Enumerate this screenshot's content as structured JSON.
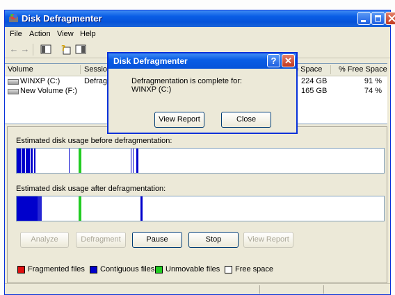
{
  "window": {
    "title": "Disk Defragmenter"
  },
  "menu": [
    "File",
    "Action",
    "View",
    "Help"
  ],
  "table": {
    "columns": [
      "Volume",
      "Session",
      "e Space",
      "% Free Space"
    ],
    "rows": [
      {
        "volume": "WINXP (C:)",
        "session": "Defragm",
        "free_space": "224 GB",
        "pct_free": "91 %"
      },
      {
        "volume": "New Volume (F:)",
        "session": "",
        "free_space": "165 GB",
        "pct_free": "74 %"
      }
    ]
  },
  "before_label": "Estimated disk usage before defragmentation:",
  "after_label": "Estimated disk usage after defragmentation:",
  "buttons": {
    "analyze": "Analyze",
    "defragment": "Defragment",
    "pause": "Pause",
    "stop": "Stop",
    "view_report": "View Report"
  },
  "legend": [
    "Fragmented files",
    "Contiguous files",
    "Unmovable files",
    "Free space"
  ],
  "colors": {
    "fragmented": "#e01010",
    "contiguous": "#0000cc",
    "unmovable": "#22cc22",
    "free": "#ffffff"
  },
  "dialog": {
    "title": "Disk Defragmenter",
    "message": "Defragmentation is complete for:",
    "volume": "WINXP (C:)",
    "view_report": "View Report",
    "close": "Close",
    "help_glyph": "?",
    "close_glyph": "✕"
  }
}
